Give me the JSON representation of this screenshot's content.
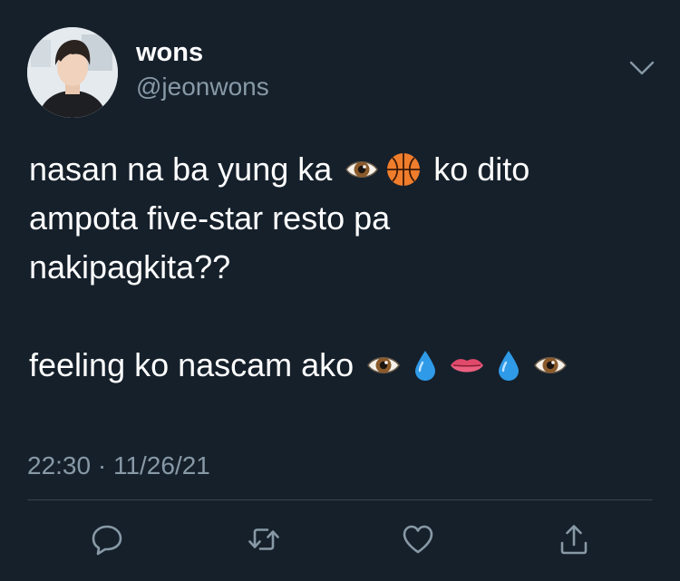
{
  "tweet": {
    "author": {
      "display_name": "wons",
      "handle": "@jeonwons",
      "avatar_icon": "profile-photo"
    },
    "text": {
      "line1_a": "nasan na ba yung ka",
      "line1_b": "ko dito",
      "line2": "ampota five-star resto pa",
      "line3": "nakipagkita??",
      "line4": "feeling ko nascam ako"
    },
    "emojis": {
      "line1": [
        "eye-emoji",
        "basketball-emoji"
      ],
      "line4": [
        "eye-emoji",
        "droplet-emoji",
        "lips-emoji",
        "droplet-emoji",
        "eye-emoji"
      ]
    },
    "timestamp": "22:30 · 11/26/21",
    "actions": [
      "reply-icon",
      "retweet-icon",
      "like-icon",
      "share-icon"
    ]
  },
  "colors": {
    "background": "#15202b",
    "text_primary": "#ffffff",
    "text_secondary": "#8899a6",
    "divider": "#38444d"
  }
}
